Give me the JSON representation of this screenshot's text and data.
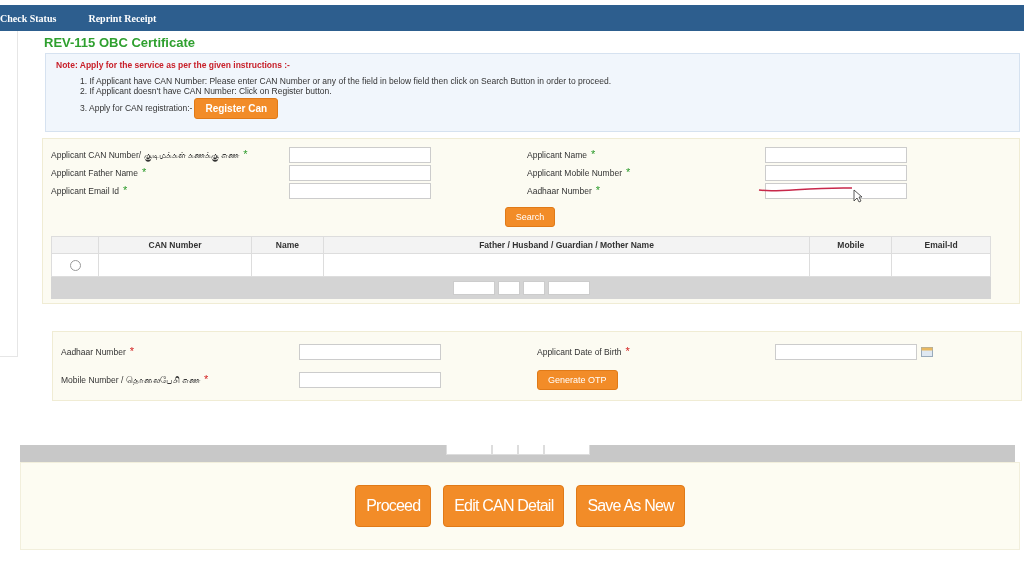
{
  "nav": [
    {
      "label": "Check Status"
    },
    {
      "label": "Reprint Receipt"
    }
  ],
  "title": "REV-115 OBC Certificate",
  "note": {
    "heading": "Note: Apply for the service as per the given instructions :-",
    "items": [
      "1. If Applicant have CAN Number: Please enter CAN Number or any of the field in below field then click on Search Button in order to proceed.",
      "2. If Applicant doesn't have CAN Number: Click on Register button.",
      "3. Apply for CAN registration:-"
    ],
    "register_button": "Register Can"
  },
  "search_form": {
    "fields": [
      {
        "label": "Applicant CAN Number/ குடிமக்கள் கணக்கு எண",
        "required_mark": "*",
        "marked": false
      },
      {
        "label": "Applicant Name",
        "required_mark": "*",
        "marked": false
      },
      {
        "label": "Applicant Father Name",
        "required_mark": "*",
        "marked": false
      },
      {
        "label": "Applicant Mobile Number",
        "required_mark": "*",
        "marked": false
      },
      {
        "label": "Applicant Email Id",
        "required_mark": "*",
        "marked": false
      },
      {
        "label": "Aadhaar Number",
        "required_mark": "*",
        "marked": true
      }
    ],
    "button": "Search"
  },
  "results": {
    "columns": [
      "CAN Number",
      "Name",
      "Father / Husband / Guardian / Mother Name",
      "Mobile",
      "Email-Id"
    ],
    "rows": [
      {
        "selected": false
      }
    ]
  },
  "otp_form": {
    "fields": [
      {
        "label": "Aadhaar Number",
        "required_mark": "*",
        "kind": "text"
      },
      {
        "label": "Applicant Date of Birth",
        "required_mark": "*",
        "kind": "date"
      },
      {
        "label": "Mobile Number / தொலைபேசி எண",
        "required_mark": "*",
        "kind": "text"
      }
    ],
    "button": "Generate OTP"
  },
  "actions": [
    "Proceed",
    "Edit CAN Detail",
    "Save As New"
  ]
}
